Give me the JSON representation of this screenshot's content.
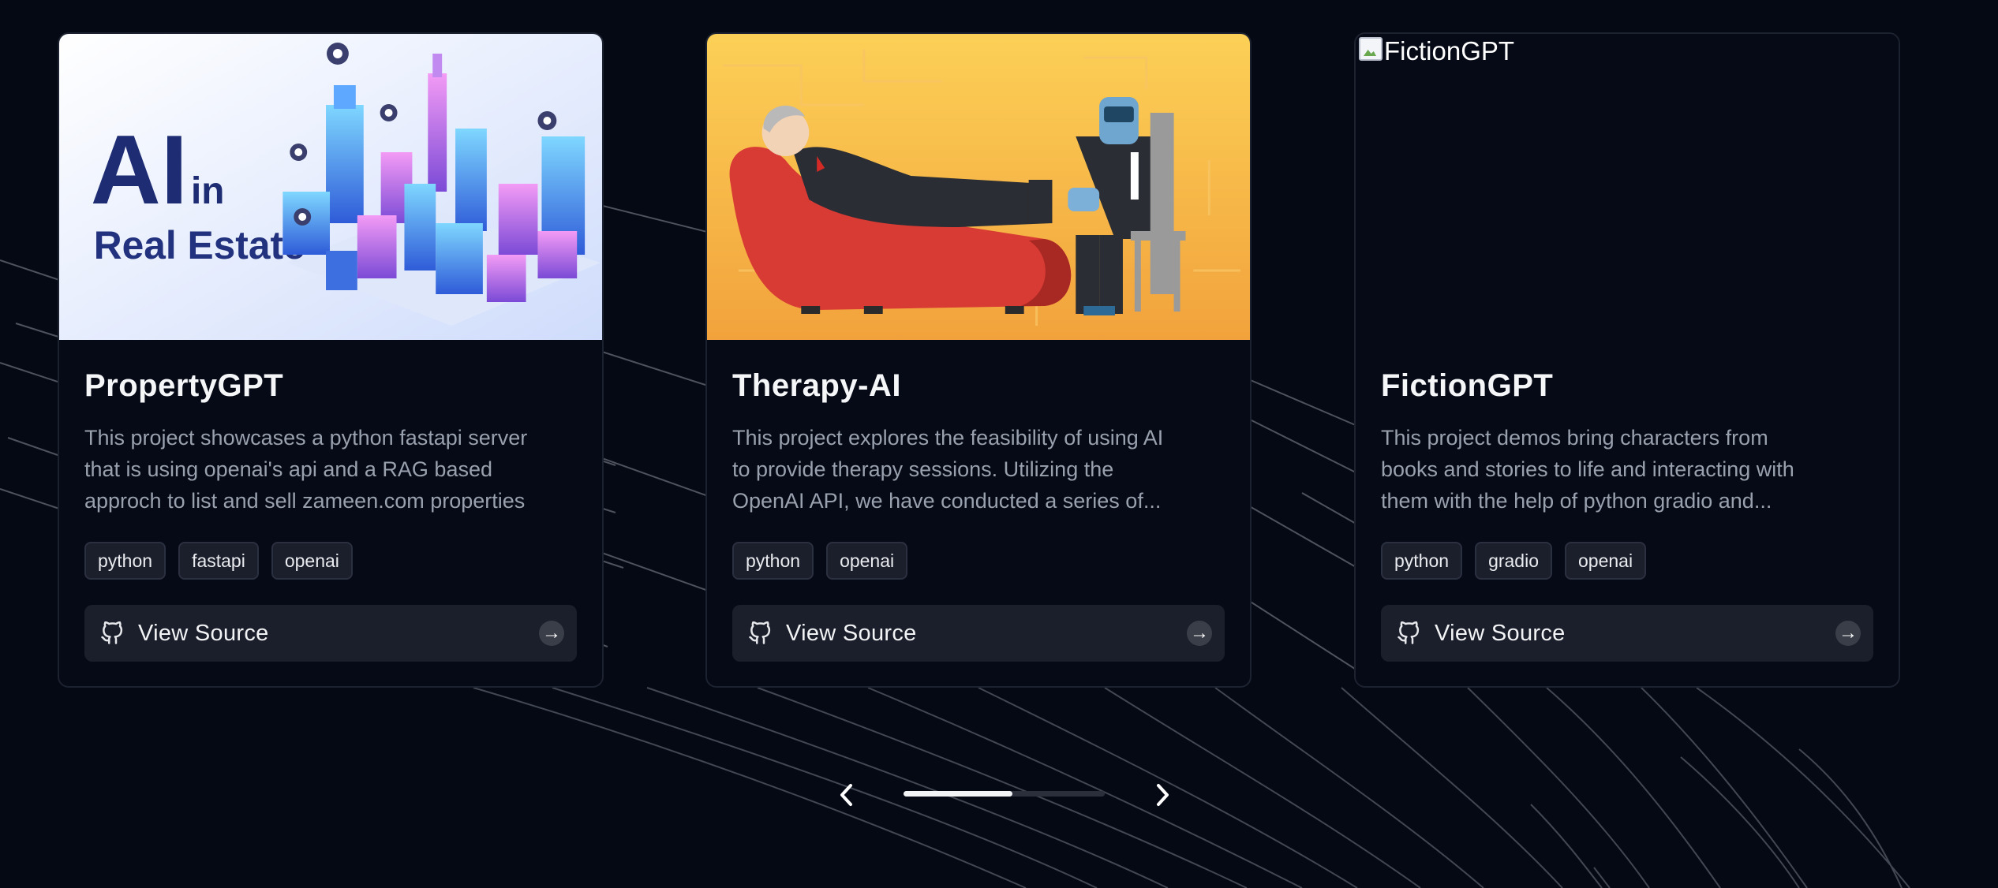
{
  "projects": [
    {
      "image_caption": "AI in Real Estate",
      "image_caption_lines": [
        "AI",
        "in",
        "Real Estate"
      ],
      "title": "PropertyGPT",
      "description": "This project showcases a python fastapi server\nthat is using openai's api and a RAG based\napproch to list and sell zameen.com properties",
      "tags": [
        "python",
        "fastapi",
        "openai"
      ],
      "cta_label": "View Source"
    },
    {
      "title": "Therapy-AI",
      "description": "This project explores the feasibility of using AI\nto provide therapy sessions. Utilizing the\nOpenAI API, we have conducted a series of...",
      "tags": [
        "python",
        "openai"
      ],
      "cta_label": "View Source"
    },
    {
      "image_alt": "FictionGPT",
      "title": "FictionGPT",
      "description": "This project demos bring characters from\nbooks and stories to life and interacting with\nthem with the help of python gradio and...",
      "tags": [
        "python",
        "gradio",
        "openai"
      ],
      "cta_label": "View Source"
    }
  ],
  "carousel": {
    "prev_icon": "chevron-left-icon",
    "next_icon": "chevron-right-icon",
    "progress": 0.54
  },
  "colors": {
    "background": "#050913",
    "card": "#060a16",
    "tag_bg": "#1b1f2b",
    "text_muted": "#9aa1ae"
  },
  "icons": {
    "source": "github-icon",
    "cta_arrow": "arrow-right-icon"
  }
}
